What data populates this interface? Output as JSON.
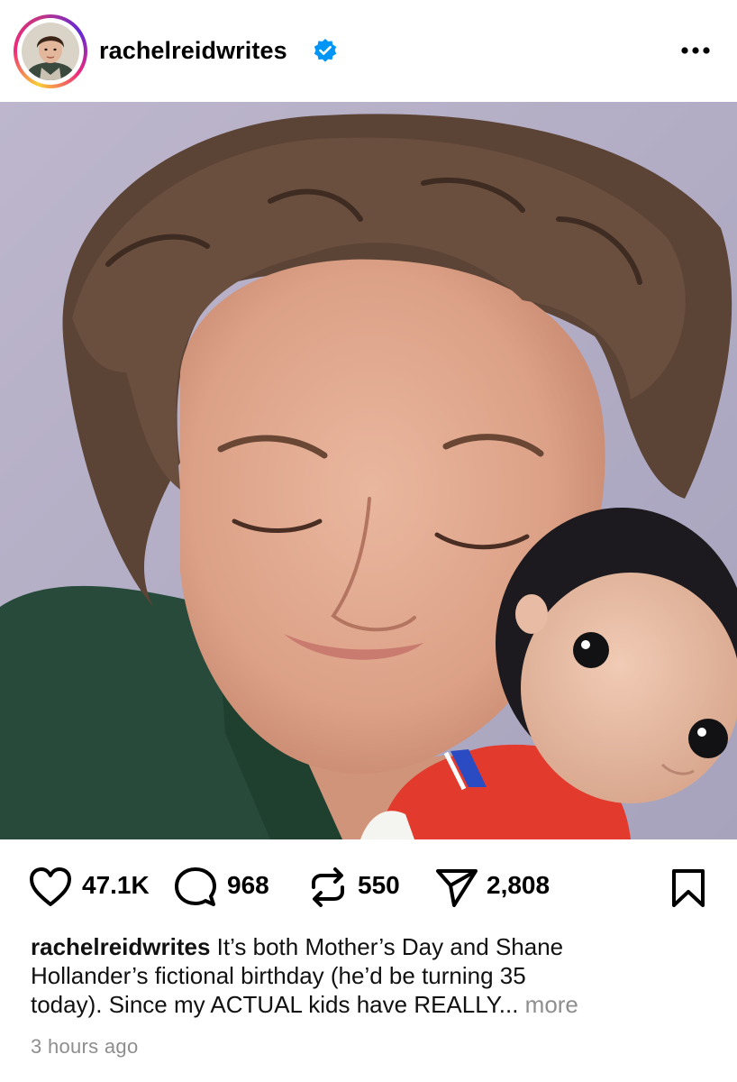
{
  "post": {
    "username": "rachelreidwrites",
    "verified": true,
    "more_icon": "more-horizontal-icon",
    "photo_description": "selfie of a woman with curly hair, eyes closed, holding a crocheted doll in a red hockey jersey against her cheek"
  },
  "actions": {
    "likes": "47.1K",
    "comments": "968",
    "reposts": "550",
    "shares": "2,808"
  },
  "caption": {
    "username": "rachelreidwrites",
    "line1": " It’s both Mother’s Day and Shane",
    "line2": "Hollander’s fictional birthday (he’d be turning 35",
    "line3": "today). Since my ACTUAL kids have REALLY... ",
    "more": "more"
  },
  "timestamp": "3 hours ago",
  "colors": {
    "verified": "#0095f6",
    "muted": "#8e8e8e",
    "text": "#000000"
  }
}
